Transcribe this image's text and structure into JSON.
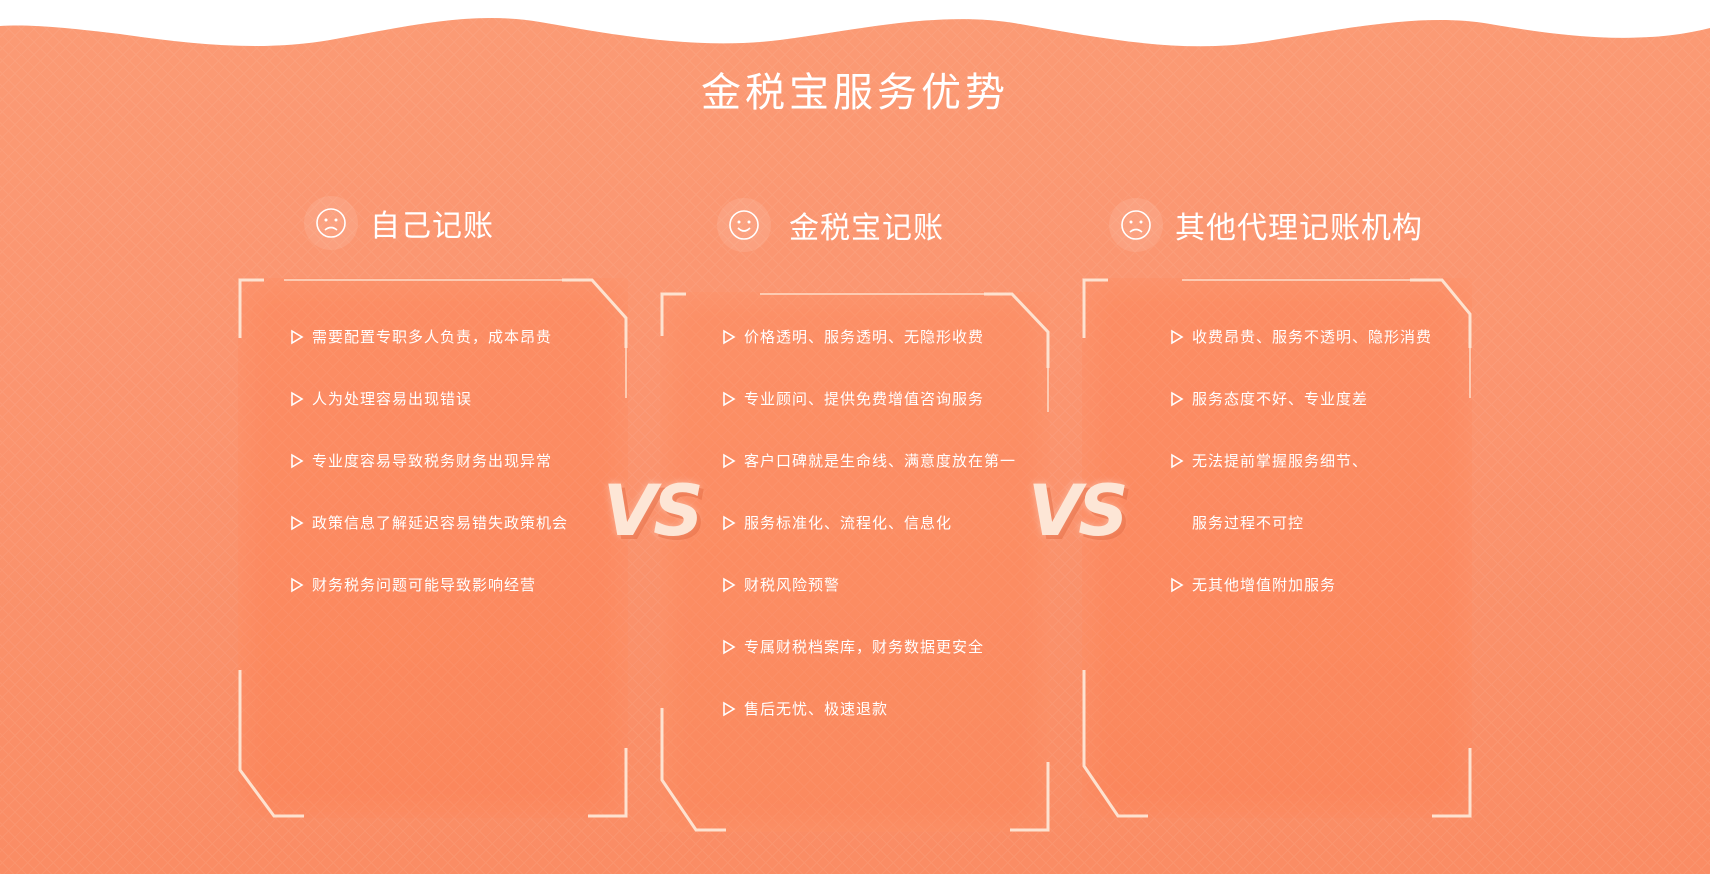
{
  "page": {
    "title": "金税宝服务优势"
  },
  "vs_label": "VS",
  "columns": [
    {
      "heading": "自己记账",
      "face_icon": "sad-face-icon",
      "items": [
        "需要配置专职多人负责，成本昂贵",
        "人为处理容易出现错误",
        "专业度容易导致税务财务出现异常",
        "政策信息了解延迟容易错失政策机会",
        "财务税务问题可能导致影响经营"
      ]
    },
    {
      "heading": "金税宝记账",
      "face_icon": "smile-face-icon",
      "items": [
        "价格透明、服务透明、无隐形收费",
        "专业顾问、提供免费增值咨询服务",
        "客户口碑就是生命线、满意度放在第一",
        "服务标准化、流程化、信息化",
        "财税风险预警",
        "专属财税档案库，财务数据更安全",
        "售后无忧、极速退款"
      ]
    },
    {
      "heading": "其他代理记账机构",
      "face_icon": "sad-face-icon",
      "items": [
        "收费昂贵、服务不透明、隐形消费",
        "服务态度不好、专业度差",
        "无法提前掌握服务细节、",
        "服务过程不可控",
        "无其他增值附加服务"
      ]
    }
  ],
  "colors": {
    "background": "#fb9570",
    "text": "#ffffff",
    "vs": "#fde6d6",
    "frame": "#fde2d0"
  }
}
